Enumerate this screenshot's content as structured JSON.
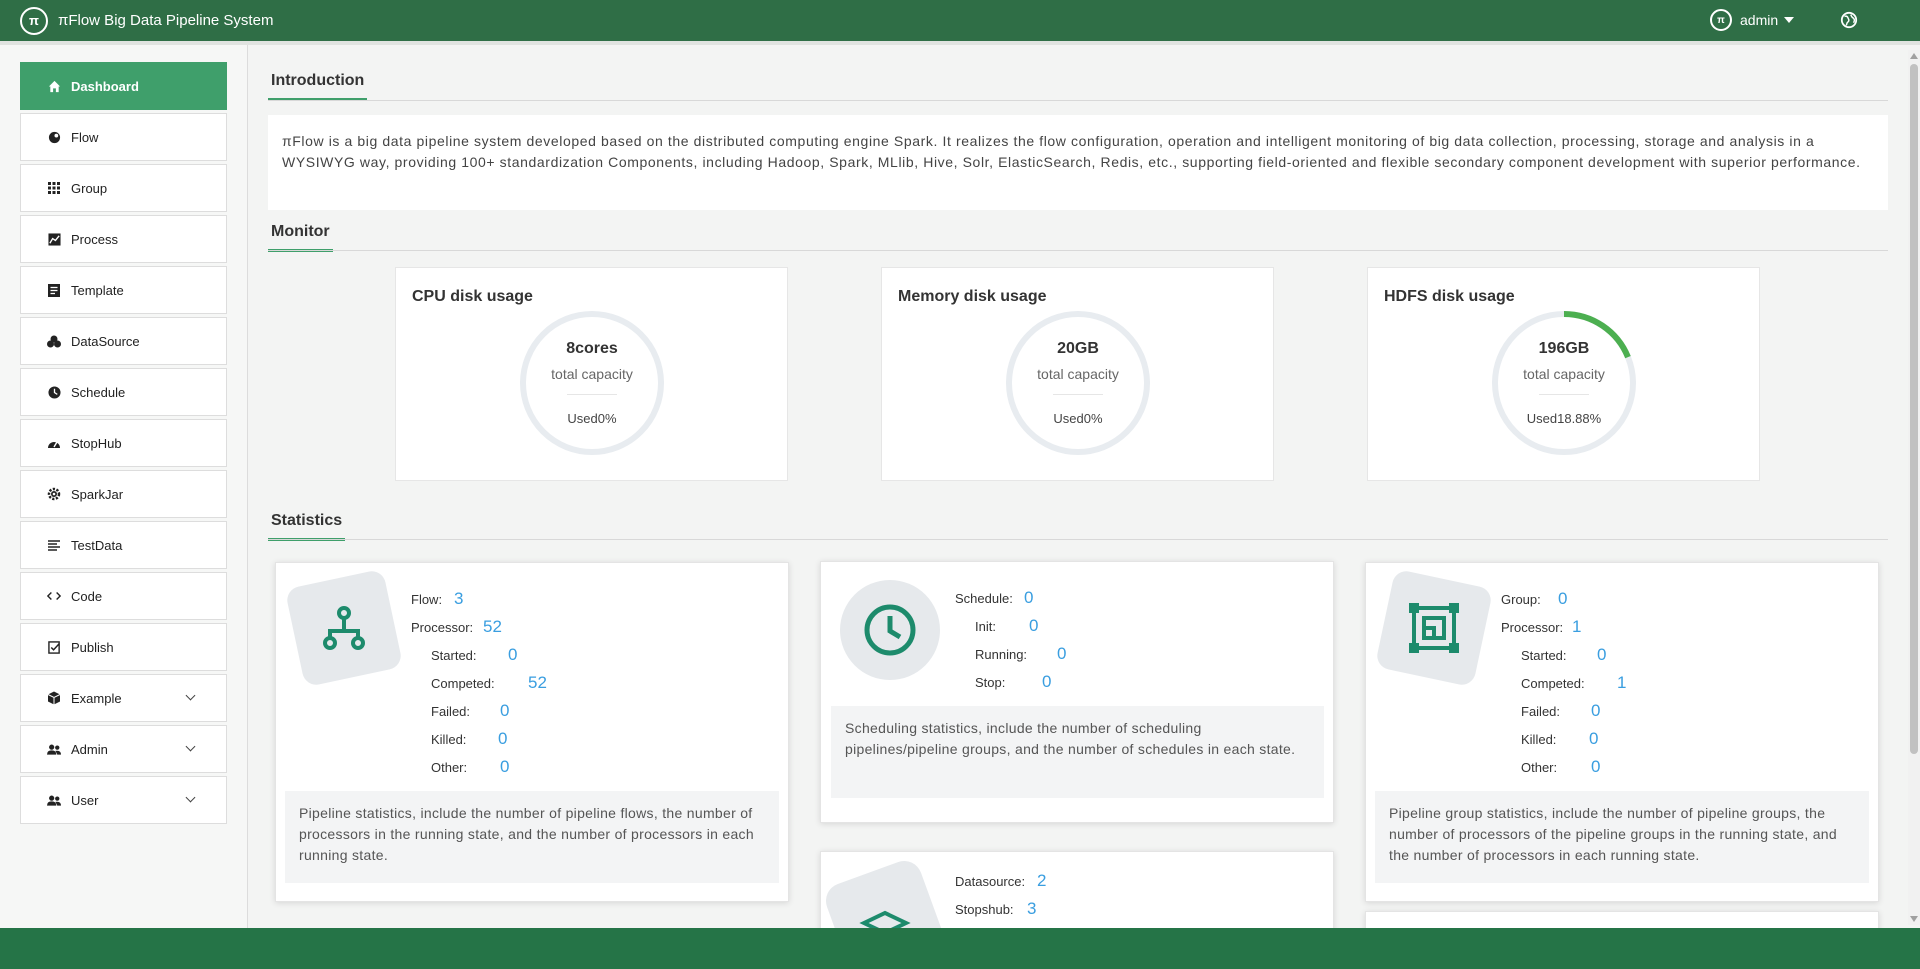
{
  "header": {
    "logo": "π",
    "title": "πFlow Big Data Pipeline System",
    "user": "admin"
  },
  "sidebar": {
    "items": [
      {
        "label": "Dashboard",
        "icon": "home-icon"
      },
      {
        "label": "Flow",
        "icon": "flow-icon"
      },
      {
        "label": "Group",
        "icon": "grid-icon"
      },
      {
        "label": "Process",
        "icon": "chart-icon"
      },
      {
        "label": "Template",
        "icon": "template-icon"
      },
      {
        "label": "DataSource",
        "icon": "datasource-icon"
      },
      {
        "label": "Schedule",
        "icon": "clock-icon"
      },
      {
        "label": "StopHub",
        "icon": "gauge-icon"
      },
      {
        "label": "SparkJar",
        "icon": "gear-icon"
      },
      {
        "label": "TestData",
        "icon": "list-icon"
      },
      {
        "label": "Code",
        "icon": "code-icon"
      },
      {
        "label": "Publish",
        "icon": "check-icon"
      },
      {
        "label": "Example",
        "icon": "cube-icon"
      },
      {
        "label": "Admin",
        "icon": "users-icon"
      },
      {
        "label": "User",
        "icon": "users-icon"
      }
    ]
  },
  "sections": {
    "intro": "Introduction",
    "monitor": "Monitor",
    "statistics": "Statistics"
  },
  "intro_text": "πFlow is a big data pipeline system developed based on the distributed computing engine Spark. It realizes the flow configuration, operation and intelligent monitoring of big data collection, processing, storage and analysis in a WYSIWYG way, providing 100+ standardization Components, including Hadoop, Spark, MLlib, Hive, Solr, ElasticSearch, Redis, etc., supporting field-oriented and flexible secondary component development with superior performance.",
  "monitor": [
    {
      "title": "CPU disk usage",
      "value": "8cores",
      "caption": "total capacity",
      "used": "Used0%",
      "fraction": 0
    },
    {
      "title": "Memory disk usage",
      "value": "20GB",
      "caption": "total capacity",
      "used": "Used0%",
      "fraction": 0
    },
    {
      "title": "HDFS disk usage",
      "value": "196GB",
      "caption": "total capacity",
      "used": "Used18.88%",
      "fraction": 0.1888
    }
  ],
  "accent_color": "#3f9f6b",
  "gauge_color": "#4caf50",
  "stats": {
    "flow": {
      "rows": [
        {
          "label": "Flow:",
          "value": "3"
        },
        {
          "label": "Processor:",
          "value": "52"
        },
        {
          "label": "Started:",
          "value": "0"
        },
        {
          "label": "Competed:",
          "value": "52"
        },
        {
          "label": "Failed:",
          "value": "0"
        },
        {
          "label": "Killed:",
          "value": "0"
        },
        {
          "label": "Other:",
          "value": "0"
        }
      ],
      "desc": "Pipeline statistics, include the number of pipeline flows, the number of processors in the running state, and the number of processors in each running state."
    },
    "schedule": {
      "rows": [
        {
          "label": "Schedule:",
          "value": "0"
        },
        {
          "label": "Init:",
          "value": "0"
        },
        {
          "label": "Running:",
          "value": "0"
        },
        {
          "label": "Stop:",
          "value": "0"
        }
      ],
      "desc": "Scheduling statistics, include the number of scheduling pipelines/pipeline groups, and the number of schedules in each state."
    },
    "group": {
      "rows": [
        {
          "label": "Group:",
          "value": "0"
        },
        {
          "label": "Processor:",
          "value": "1"
        },
        {
          "label": "Started:",
          "value": "0"
        },
        {
          "label": "Competed:",
          "value": "1"
        },
        {
          "label": "Failed:",
          "value": "0"
        },
        {
          "label": "Killed:",
          "value": "0"
        },
        {
          "label": "Other:",
          "value": "0"
        }
      ],
      "desc": "Pipeline group statistics, include the number of pipeline groups, the number of processors of the pipeline groups in the running state, and the number of processors in each running state."
    },
    "datasource": {
      "rows": [
        {
          "label": "Datasource:",
          "value": "2"
        },
        {
          "label": "Stopshub:",
          "value": "3"
        }
      ]
    }
  }
}
